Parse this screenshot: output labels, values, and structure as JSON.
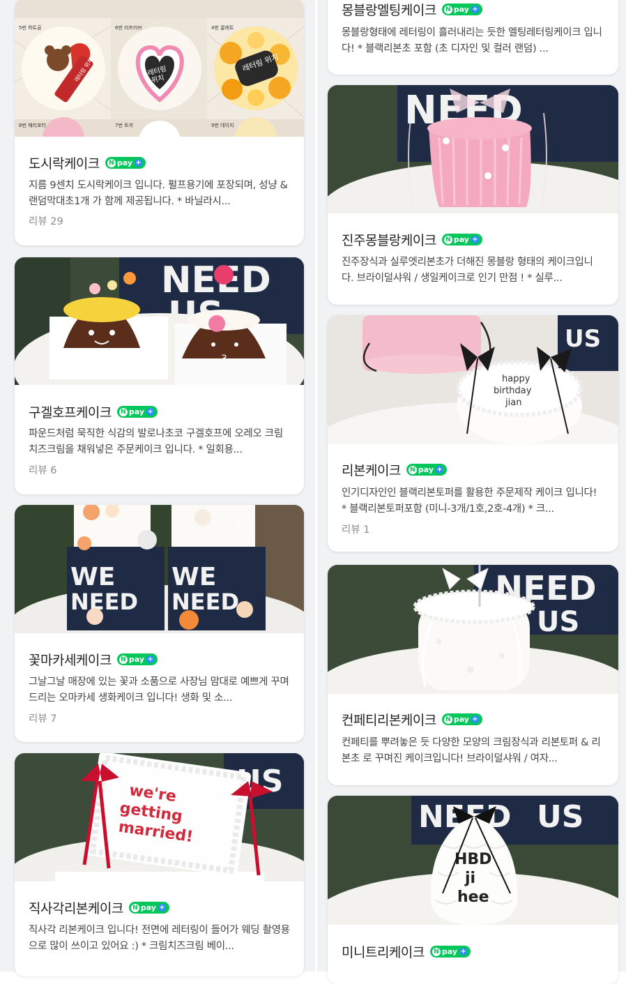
{
  "npay": {
    "label": "pay",
    "n": "N",
    "plus": "+"
  },
  "left_cards": [
    {
      "title": "도시락케이크",
      "description": "지름 9센치 도시락케이크 입니다. 펄프용기에 포장되며, 성냥 & 랜덤막대초1개 가 함께 제공됩니다. * 바닐라시...",
      "review": "리뷰 29",
      "image_labels": [
        "5번 하트곰",
        "6번 러프러브",
        "4번 꿀레트",
        "8번 해리포터",
        "7번 토끼",
        "9번 데이지"
      ],
      "image_lettering": [
        "레터링 위치",
        "레터링 위치"
      ]
    },
    {
      "title": "구겔호프케이크",
      "description": "파운드처럼 묵직한 식감의 발로나초코 구겔호프에 오레오 크림치즈크림을 채워넣은 주문케이크 입니다. * 일회용...",
      "review": "리뷰 6"
    },
    {
      "title": "꽃마카세케이크",
      "description": "그날그날 매장에 있는 꽃과 소품으로 사장님 맘대로 예쁘게 꾸며드리는 오마카세 생화케이크 입니다! 생화 및 소...",
      "review": "리뷰 7"
    },
    {
      "title": "직사각리본케이크",
      "description": "직사각 리본케이크 입니다! 전면에 레터링이 들어가 웨딩 촬영용으로 많이 쓰이고 있어요 :) * 크림치즈크림 베이...",
      "review": "",
      "image_lettering": [
        "we're",
        "getting",
        "married!"
      ]
    }
  ],
  "right_cards": [
    {
      "title": "몽블랑멜팅케이크",
      "description": "몽블랑형태에 레터링이 흘러내리는 듯한 멜팅레터링케이크 입니다! * 블랙리본초 포함 (초 디자인 및 컬러 랜덤) ...",
      "review": ""
    },
    {
      "title": "진주몽블랑케이크",
      "description": "진주장식과 실루엣리본초가 더해진 몽블랑 형태의 케이크입니다. 브라이덜샤워 / 생일케이크로 인기 만점 ! * 실루...",
      "review": ""
    },
    {
      "title": "리본케이크",
      "description": "인기디자인인 블랙리본토퍼를 활용한 주문제작 케이크 입니다! * 블랙리본토퍼포함 (미니-3개/1호,2호-4개) * 크...",
      "review": "리뷰 1",
      "image_lettering": [
        "happy",
        "birthday",
        "jian"
      ]
    },
    {
      "title": "컨페티리본케이크",
      "description": "컨페티를 뿌려놓은 듯 다양한 모양의 크림장식과 리본토퍼 & 리본초 로 꾸며진 케이크입니다! 브라이덜샤워 / 여자...",
      "review": ""
    },
    {
      "title": "미니트리케이크",
      "description": "",
      "review": "",
      "image_lettering": [
        "HBD",
        "ji",
        "hee"
      ]
    }
  ],
  "box_text": {
    "we": "WE",
    "need": "NEED",
    "us": "US"
  },
  "colors": {
    "npay_green": "#03c75a",
    "npay_plus_blue": "#2b8cff",
    "panel_bg": "#f1f2f4"
  }
}
